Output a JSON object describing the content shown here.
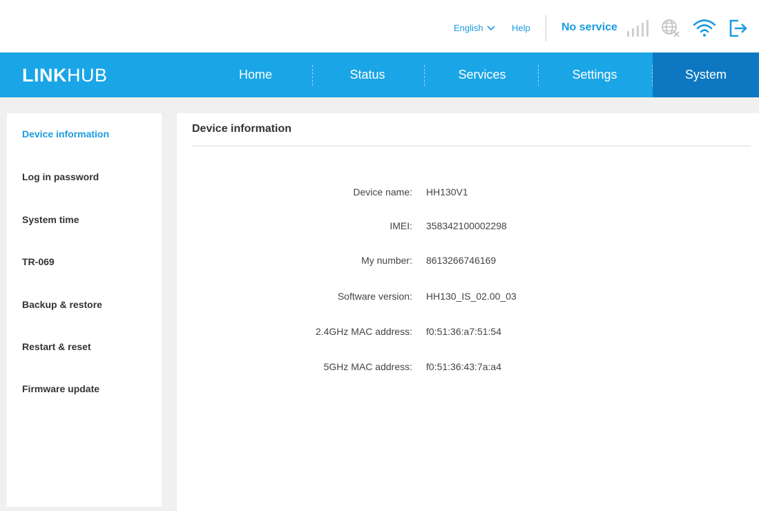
{
  "header": {
    "language": "English",
    "help_label": "Help",
    "connection_status": "No service",
    "icons": [
      "chevron-down-icon",
      "signal-bars-icon",
      "globe-no-internet-icon",
      "wifi-icon",
      "logout-icon"
    ],
    "accent_color": "#1a9be0"
  },
  "brand": {
    "logo_bold": "LINK",
    "logo_thin": "HUB"
  },
  "nav": {
    "items": [
      {
        "label": "Home"
      },
      {
        "label": "Status"
      },
      {
        "label": "Services"
      },
      {
        "label": "Settings"
      },
      {
        "label": "System"
      }
    ],
    "active": "System",
    "bar_color": "#1aa5e6",
    "active_color": "#0d78c1"
  },
  "sidebar": {
    "items": [
      {
        "label": "Device information"
      },
      {
        "label": "Log in password"
      },
      {
        "label": "System time"
      },
      {
        "label": "TR-069"
      },
      {
        "label": "Backup & restore"
      },
      {
        "label": "Restart & reset"
      },
      {
        "label": "Firmware update"
      }
    ],
    "active": "Device information"
  },
  "main": {
    "title": "Device information",
    "fields": [
      {
        "label": "Device name:",
        "value": "HH130V1"
      },
      {
        "label": "IMEI:",
        "value": "358342100002298"
      },
      {
        "label": "My number:",
        "value": "8613266746169"
      },
      {
        "label": "Software version:",
        "value": "HH130_IS_02.00_03"
      },
      {
        "label": "2.4GHz MAC address:",
        "value": "f0:51:36:a7:51:54"
      },
      {
        "label": "5GHz MAC address:",
        "value": "f0:51:36:43:7a:a4"
      }
    ]
  }
}
